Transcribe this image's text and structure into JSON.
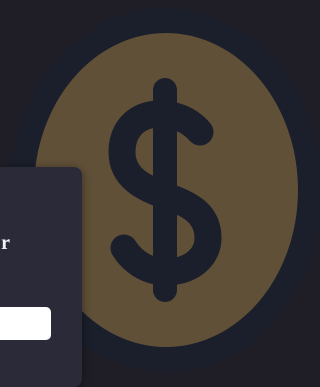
{
  "background": {
    "color": "#1f1e27"
  },
  "coin": {
    "icon": "dollar-coin-icon",
    "symbol": "$",
    "fill_color": "#615038",
    "ring_color": "#1a1f2b",
    "symbol_color": "#1a1f2b"
  },
  "card": {
    "background_color": "#2a2a38",
    "title_visible_fragment": "r",
    "input": {
      "value": "",
      "placeholder": ""
    }
  }
}
